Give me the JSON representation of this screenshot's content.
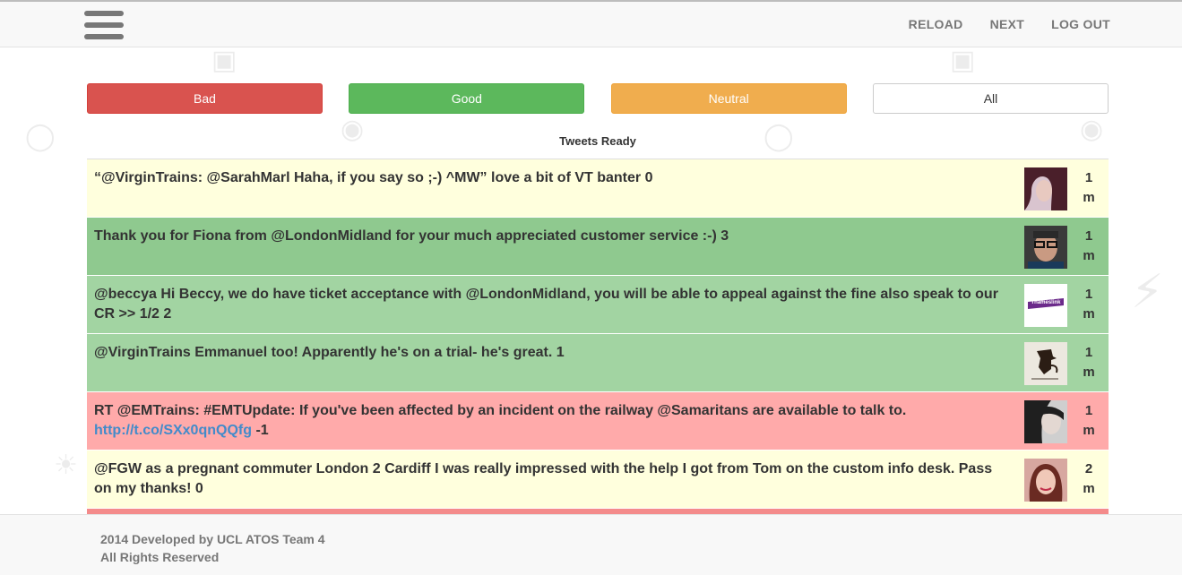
{
  "nav": {
    "reload": "RELOAD",
    "next": "NEXT",
    "logout": "LOG OUT"
  },
  "filters": {
    "bad": "Bad",
    "good": "Good",
    "neutral": "Neutral",
    "all": "All"
  },
  "status": "Tweets Ready",
  "tweets": [
    {
      "text": "“@VirginTrains: @SarahMarl Haha, if you say so ;-) ^MW” love a bit of VT banter 0",
      "age_num": "1",
      "age_unit": "m",
      "color": "#ffffdd"
    },
    {
      "text": "Thank you for Fiona from @LondonMidland for your much appreciated customer service :-) 3",
      "age_num": "1",
      "age_unit": "m",
      "color": "#8fc98f"
    },
    {
      "text": "@beccya Hi Beccy, we do have ticket acceptance with @LondonMidland, you will be able to appeal against the fine also speak to our CR >> 1/2 2",
      "age_num": "1",
      "age_unit": "m",
      "color": "#a2d4a2"
    },
    {
      "text": "@VirginTrains Emmanuel too! Apparently he's on a trial- he's great. 1",
      "age_num": "1",
      "age_unit": "m",
      "color": "#a2d4a2"
    },
    {
      "text_before": "RT @EMTrains: #EMTUpdate: If you've been affected by an incident on the railway @Samaritans are available to talk to.",
      "link": "http://t.co/SXx0qnQQfg",
      "text_after": "-1",
      "age_num": "1",
      "age_unit": "m",
      "color": "#ffaaaa"
    },
    {
      "text": "@FGW as a pregnant commuter London 2 Cardiff I was really impressed with the help I got from Tom on the custom info desk. Pass on my thanks! 0",
      "age_num": "2",
      "age_unit": "m",
      "color": "#ffffdd"
    }
  ],
  "avatar_thumb_text": "Thameslink",
  "footer": {
    "line1": "2014 Developed by UCL ATOS Team 4",
    "line2": "All Rights Reserved"
  }
}
